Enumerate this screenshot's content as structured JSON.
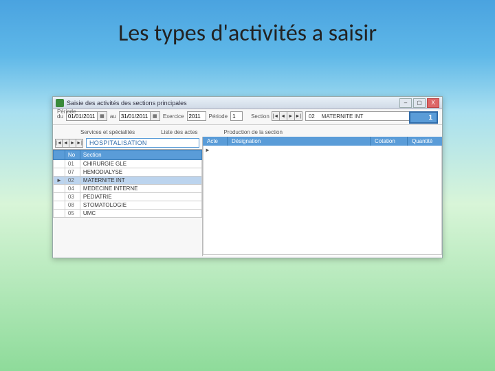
{
  "slide": {
    "title": "Les types d'activités a saisir"
  },
  "window": {
    "title": "Saisie des activités des sections principales",
    "btn_min": "–",
    "btn_max": "▢",
    "btn_close": "X"
  },
  "periode": {
    "group_label": "Période",
    "du_label": "du",
    "du_value": "01/01/2011",
    "au_label": "au",
    "au_value": "31/01/2011",
    "exercice_label": "Exercice",
    "exercice_value": "2011",
    "periode_label": "Période",
    "periode_value": "1",
    "section_label": "Section",
    "section_code": "02",
    "section_name": "MATERNITE INT",
    "nav_first": "|◄",
    "nav_prev": "◄",
    "nav_next": "►",
    "nav_last": "►|",
    "cal_glyph": "▦",
    "count": "1"
  },
  "tabs": {
    "t1": "Services et spécialités",
    "t2": "Liste des actes",
    "t3": "Production de la section"
  },
  "services": {
    "toolbar_title": "HOSPITALISATION",
    "col_no": "No",
    "col_section": "Section",
    "row_pointer": "►",
    "rows": [
      {
        "no": "01",
        "label": "CHIRURGIE GLE"
      },
      {
        "no": "07",
        "label": "HEMODIALYSE"
      },
      {
        "no": "02",
        "label": "MATERNITE INT"
      },
      {
        "no": "04",
        "label": "MEDECINE INTERNE"
      },
      {
        "no": "03",
        "label": "PEDIATRIE"
      },
      {
        "no": "08",
        "label": "STOMATOLOGIE"
      },
      {
        "no": "05",
        "label": "UMC"
      }
    ],
    "selected_index": 2
  },
  "actes": {
    "col_acte": "Acte",
    "col_designation": "Désignation",
    "col_cotation": "Cotation",
    "col_quantite": "Quantité",
    "pointer": "►"
  }
}
